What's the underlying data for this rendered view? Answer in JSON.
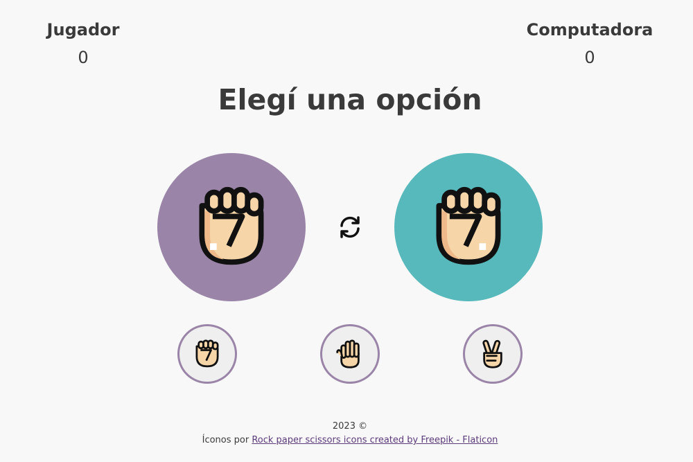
{
  "scoreboard": {
    "player": {
      "label": "Jugador",
      "score": "0"
    },
    "computer": {
      "label": "Computadora",
      "score": "0"
    }
  },
  "title": "Elegí una opción",
  "arena": {
    "player_choice": "rock-fist-icon",
    "computer_choice": "rock-fist-icon",
    "player_color": "#9a84a8",
    "computer_color": "#57b9bb",
    "swap_icon": "refresh-icon"
  },
  "options": [
    {
      "icon": "rock-fist-icon"
    },
    {
      "icon": "paper-hand-icon"
    },
    {
      "icon": "scissors-hand-icon"
    }
  ],
  "colors": {
    "option_border": "#9a84a8",
    "skin": "#f6d6a8",
    "skin_shadow": "#efb98a",
    "outline": "#111111"
  },
  "footer": {
    "copyright": "2023 ©",
    "credit_prefix": "Íconos por ",
    "credit_link": "Rock paper scissors icons created by Freepik - Flaticon"
  }
}
